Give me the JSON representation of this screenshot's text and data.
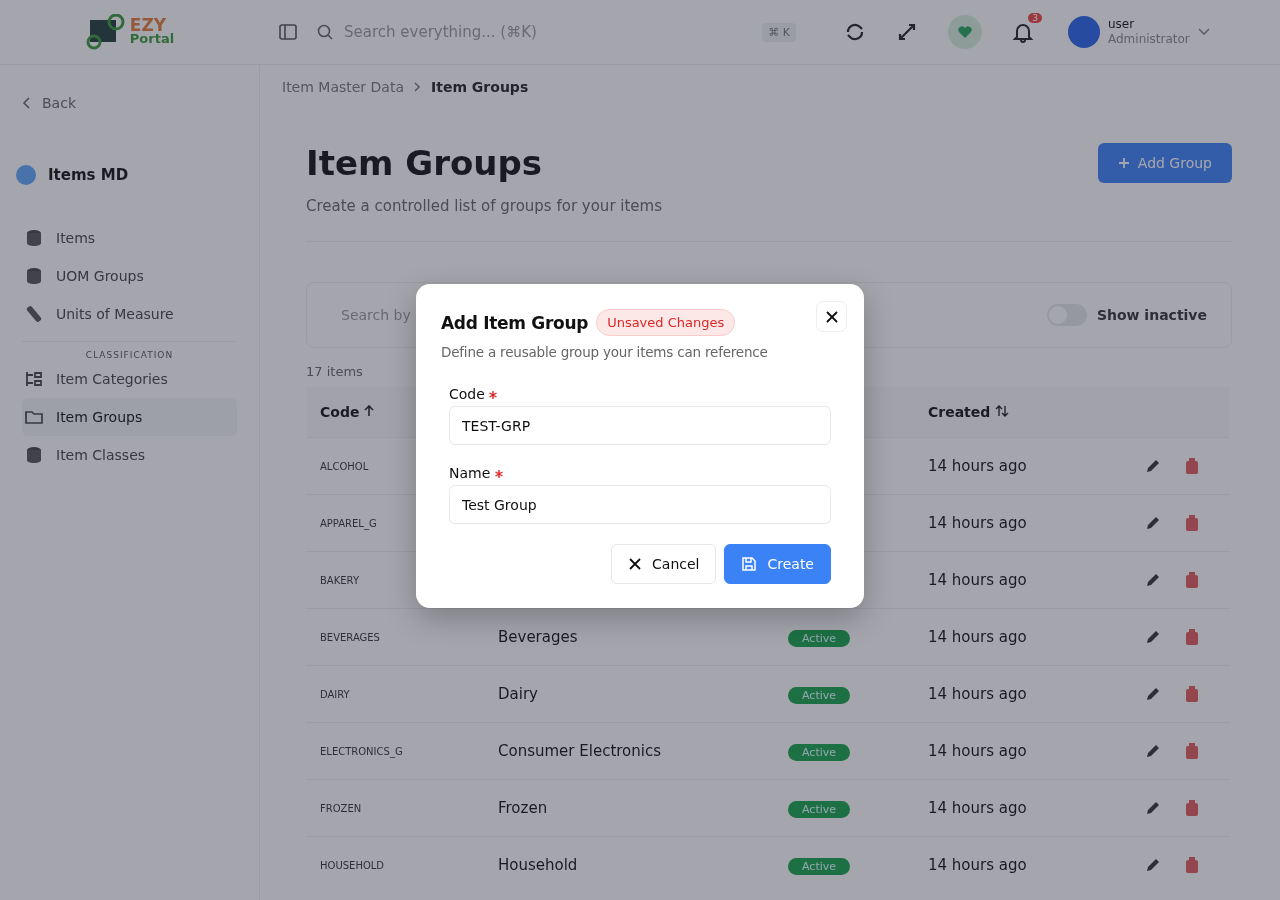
{
  "header": {
    "logo": [
      "EZY",
      "Portal"
    ],
    "search": {
      "placeholder": "Search everything... (⌘K)"
    },
    "shortcut": "⌘ K",
    "notification_count": "3",
    "user": {
      "name": "user",
      "role": "Administrator"
    }
  },
  "sidebar": {
    "back": "Back",
    "module": "Items MD",
    "items": [
      {
        "label": "Items",
        "selected": false
      },
      {
        "label": "UOM Groups",
        "selected": false
      },
      {
        "label": "Units of Measure",
        "selected": false
      }
    ],
    "section": "CLASSIFICATION",
    "section_items": [
      {
        "label": "Item Categories",
        "selected": false
      },
      {
        "label": "Item Groups",
        "selected": true
      },
      {
        "label": "Item Classes",
        "selected": false
      }
    ]
  },
  "breadcrumb": [
    "Item Master Data",
    "Item Groups"
  ],
  "page": {
    "title": "Item Groups",
    "subtitle": "Create a controlled list of groups for your items",
    "add_button": "Add Group"
  },
  "toolbar": {
    "search": {
      "placeholder": "Search by"
    },
    "toggle": {
      "label": "Show inactive",
      "on": false
    }
  },
  "count": "17 items",
  "table": {
    "columns": [
      "Code",
      "Created"
    ],
    "rows": [
      {
        "code": "ALCOHOL",
        "created": "14 hours ago"
      },
      {
        "code": "APPAREL_G",
        "created": "14 hours ago"
      },
      {
        "code": "BAKERY",
        "created": "14 hours ago"
      },
      {
        "code": "BEVERAGES",
        "name": "Beverages",
        "status": "Active",
        "created": "14 hours ago"
      },
      {
        "code": "DAIRY",
        "name": "Dairy",
        "status": "Active",
        "created": "14 hours ago"
      },
      {
        "code": "ELECTRONICS_G",
        "name": "Consumer Electronics",
        "status": "Active",
        "created": "14 hours ago"
      },
      {
        "code": "FROZEN",
        "name": "Frozen",
        "status": "Active",
        "created": "14 hours ago"
      },
      {
        "code": "HOUSEHOLD",
        "name": "Household",
        "status": "Active",
        "created": "14 hours ago"
      }
    ]
  },
  "dialog": {
    "title": "Add Item Group",
    "badge": "Unsaved Changes",
    "description": "Define a reusable group your items can reference",
    "fields": [
      {
        "label": "Code",
        "required": true,
        "value": "TEST-GRP"
      },
      {
        "label": "Name",
        "required": true,
        "value": "Test Group"
      }
    ],
    "buttons": [
      {
        "label": "Cancel",
        "kind": "secondary"
      },
      {
        "label": "Create",
        "kind": "primary"
      }
    ]
  }
}
